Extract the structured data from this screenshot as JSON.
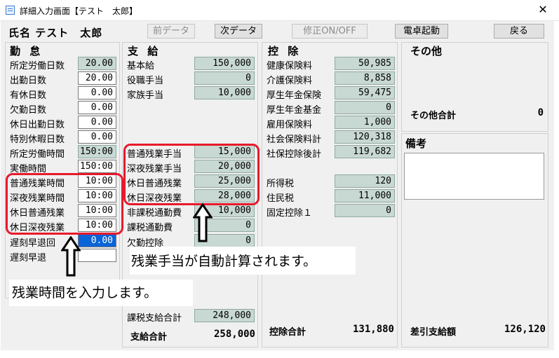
{
  "window": {
    "title": "詳細入力画面【テスト　太郎】",
    "close_glyph": "✕"
  },
  "employee_name": "氏名 テスト　太郎",
  "toolbar": {
    "prev_label": "前データ",
    "next_label": "次データ",
    "edit_toggle_label": "修正ON/OFF",
    "calculator_label": "電卓起動",
    "back_label": "戻る"
  },
  "attendance": {
    "title": "勤 怠",
    "rows": [
      {
        "label": "所定労働日数",
        "value": "20.00"
      },
      {
        "label": "出勤日数",
        "value": "20.00"
      },
      {
        "label": "有休日数",
        "value": "0.00"
      },
      {
        "label": "欠勤日数",
        "value": "0.00"
      },
      {
        "label": "休日出勤日数",
        "value": "0.00"
      },
      {
        "label": "特別休暇日数",
        "value": "0.00"
      },
      {
        "label": "所定労働時間",
        "value": "150:00"
      },
      {
        "label": "実働時間",
        "value": "150:00"
      },
      {
        "label": "普通残業時間",
        "value": "10:00"
      },
      {
        "label": "深夜残業時間",
        "value": "10:00"
      },
      {
        "label": "休日普通残業",
        "value": "10:00"
      },
      {
        "label": "休日深夜残業",
        "value": "10:00"
      },
      {
        "label": "遅刻早退回",
        "value": "0.00"
      },
      {
        "label": "遅刻早退",
        "value": ""
      }
    ]
  },
  "payment": {
    "title": "支 給",
    "rows": [
      {
        "label": "基本給",
        "value": "150,000"
      },
      {
        "label": "役職手当",
        "value": "0"
      },
      {
        "label": "家族手当",
        "value": "10,000"
      },
      {
        "label": "普通残業手当",
        "value": "15,000"
      },
      {
        "label": "深夜残業手当",
        "value": "20,000"
      },
      {
        "label": "休日普通残業",
        "value": "25,000"
      },
      {
        "label": "休日深夜残業",
        "value": "28,000"
      },
      {
        "label": "非課税通勤費",
        "value": "10,000"
      },
      {
        "label": "課税通勤費",
        "value": "0"
      },
      {
        "label": "欠勤控除",
        "value": "0"
      },
      {
        "label": "課税支給合計",
        "value": "248,000"
      }
    ],
    "total_label": "支給合計",
    "total_value": "258,000"
  },
  "deduction": {
    "title": "控 除",
    "rows": [
      {
        "label": "健康保険料",
        "value": "50,985"
      },
      {
        "label": "介護保険料",
        "value": "8,858"
      },
      {
        "label": "厚生年金保険",
        "value": "59,475"
      },
      {
        "label": "厚生年金基金",
        "value": "0"
      },
      {
        "label": "雇用保険料",
        "value": "1,000"
      },
      {
        "label": "社会保険料計",
        "value": "120,318"
      },
      {
        "label": "社保控除後計",
        "value": "119,682"
      },
      {
        "label": "所得税",
        "value": "120"
      },
      {
        "label": "住民税",
        "value": "11,000"
      },
      {
        "label": "固定控除１",
        "value": "0"
      }
    ],
    "total_label": "控除合計",
    "total_value": "131,880"
  },
  "other": {
    "title": "その他",
    "total_label": "その他合計",
    "total_value": "0",
    "remarks_label": "備考",
    "net_label": "差引支給額",
    "net_value": "126,120"
  },
  "annotations": {
    "allowance_note": "残業手当が自動計算されます。",
    "hours_note": "残業時間を入力します。"
  },
  "colors": {
    "highlight": "#e8192c",
    "readonly_field": "#c8d8d2",
    "selected_field": "#0a64d8"
  }
}
